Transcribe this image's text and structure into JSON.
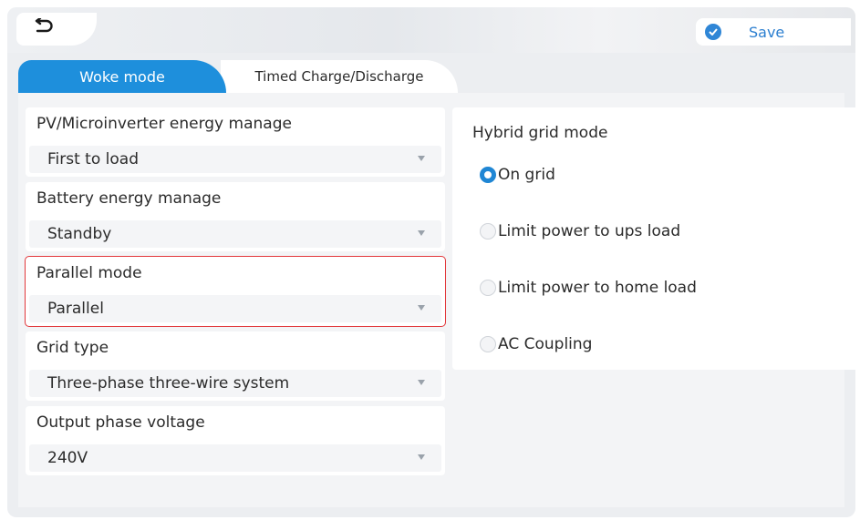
{
  "header": {
    "save_label": "Save"
  },
  "tabs": [
    {
      "label": "Woke mode",
      "active": true
    },
    {
      "label": "Timed Charge/Discharge",
      "active": false
    }
  ],
  "fields": [
    {
      "label": "PV/Microinverter energy manage",
      "value": "First to load"
    },
    {
      "label": "Battery energy manage",
      "value": "Standby"
    },
    {
      "label": "Parallel mode",
      "value": "Parallel",
      "highlighted": true
    },
    {
      "label": "Grid type",
      "value": "Three-phase three-wire system"
    },
    {
      "label": "Output phase voltage",
      "value": "240V"
    }
  ],
  "hybrid": {
    "title": "Hybrid grid mode",
    "options": [
      {
        "label": "On grid",
        "selected": true
      },
      {
        "label": "Limit power to ups load",
        "selected": false
      },
      {
        "label": "Limit power to home load",
        "selected": false
      },
      {
        "label": "AC Coupling",
        "selected": false
      }
    ]
  },
  "colors": {
    "accent": "#1e8fdc",
    "highlight_border": "#e2383b"
  }
}
